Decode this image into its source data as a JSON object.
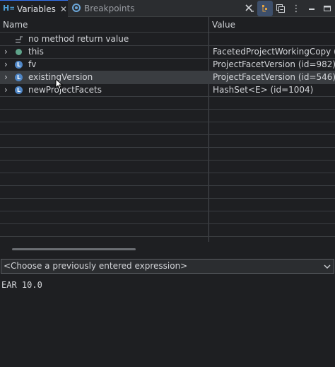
{
  "tabs": [
    {
      "label": "Variables",
      "icon": "variables-icon",
      "active": true
    },
    {
      "label": "Breakpoints",
      "icon": "breakpoints-icon",
      "active": false
    }
  ],
  "toolbar": {
    "buttons": [
      "remove-all-icon",
      "show-type-names-icon",
      "collapse-all-icon",
      "view-menu-icon",
      "minimize-icon",
      "maximize-icon"
    ]
  },
  "table": {
    "columns": [
      "Name",
      "Value"
    ],
    "rows": [
      {
        "name": "no method return value",
        "value": "",
        "icon": "method-return-icon",
        "expandable": false
      },
      {
        "name": "this",
        "value": "FacetedProjectWorkingCopy  (id=",
        "icon": "field-dot-icon",
        "expandable": true
      },
      {
        "name": "fv",
        "value": "ProjectFacetVersion  (id=982)",
        "icon": "local-variable-icon",
        "expandable": true
      },
      {
        "name": "existingVersion",
        "value": "ProjectFacetVersion  (id=546)",
        "icon": "local-variable-icon",
        "expandable": true,
        "selected": true
      },
      {
        "name": "newProjectFacets",
        "value": "HashSet<E>  (id=1004)",
        "icon": "local-variable-icon",
        "expandable": true
      }
    ]
  },
  "expression": {
    "placeholder": "<Choose a previously entered expression>"
  },
  "detail": {
    "text": "EAR 10.0"
  },
  "colors": {
    "accent": "#3574f0",
    "background": "#1e1f22",
    "selected_row": "#3a3d41"
  }
}
